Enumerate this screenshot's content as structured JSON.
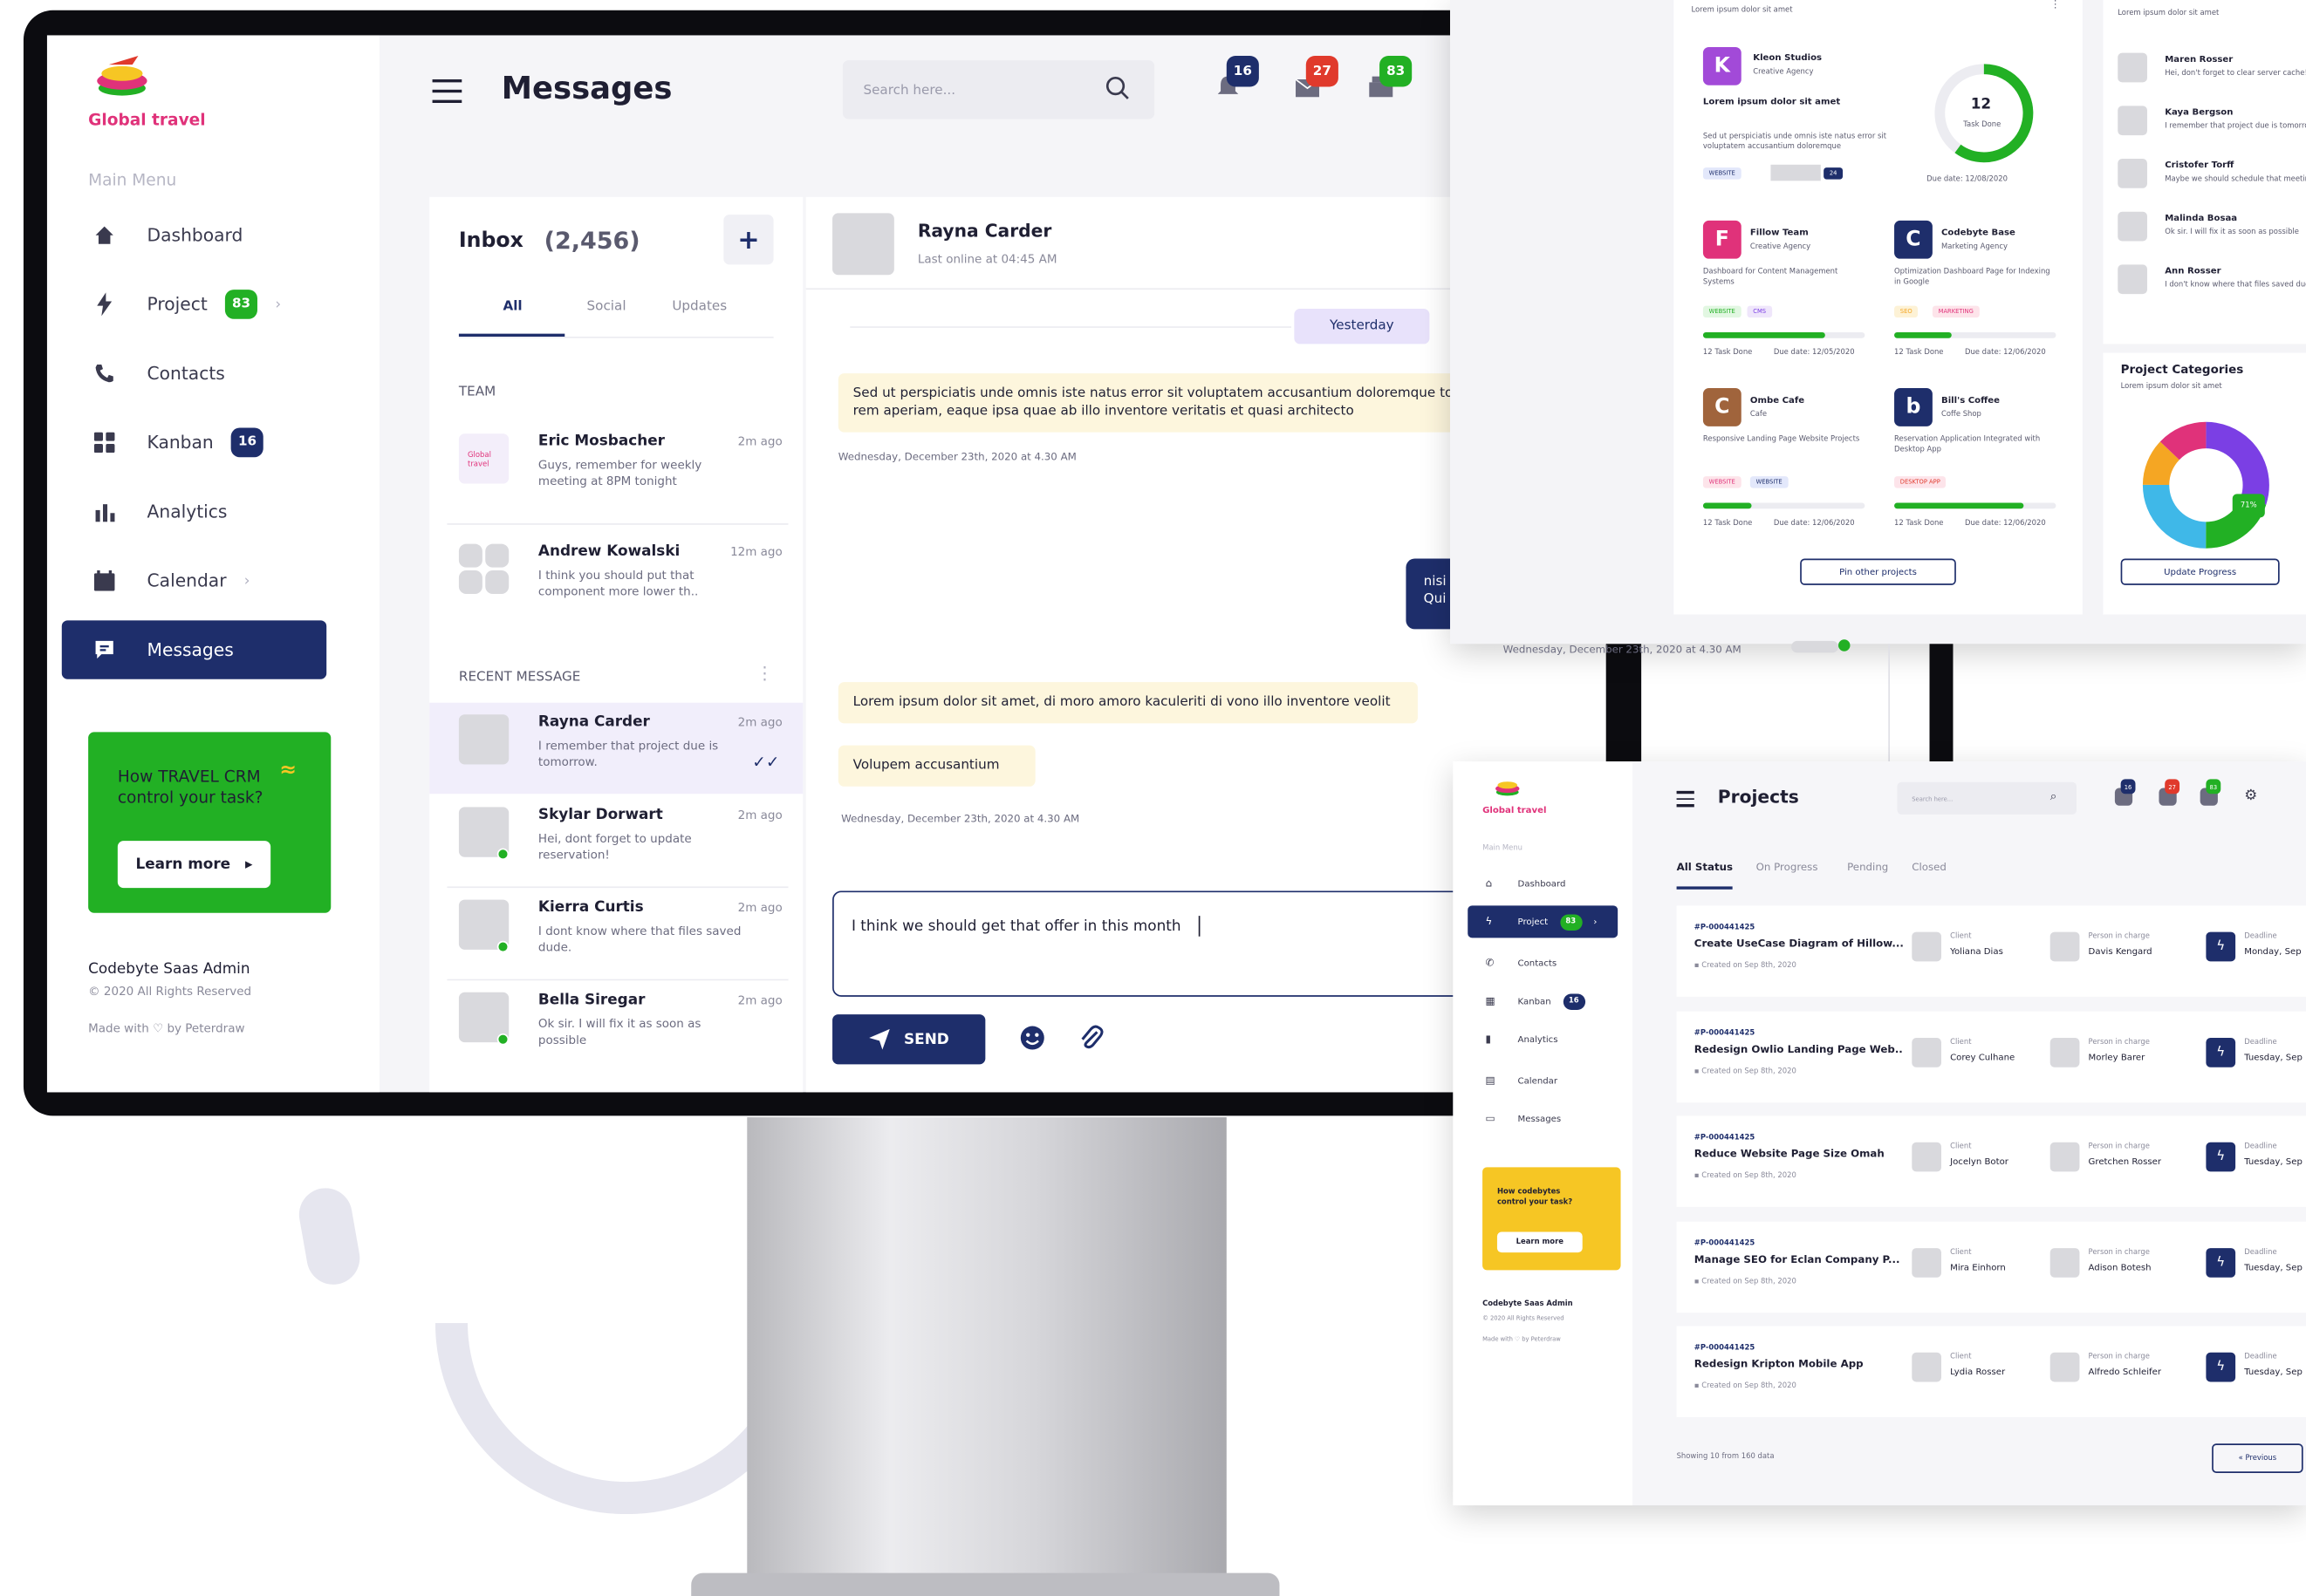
{
  "colors": {
    "primary": "#1e2e6b",
    "green": "#22b024",
    "red": "#e03a2c",
    "yellow": "#f6c624",
    "pink": "#e0327a"
  },
  "app": {
    "logo_text": "Global travel",
    "menu_title": "Main Menu",
    "page_title": "Messages",
    "search_placeholder": "Search here..."
  },
  "nav": [
    {
      "label": "Dashboard",
      "icon": "home-icon"
    },
    {
      "label": "Project",
      "icon": "bolt-icon",
      "badge": "83"
    },
    {
      "label": "Contacts",
      "icon": "phone-icon"
    },
    {
      "label": "Kanban",
      "icon": "grid-icon",
      "badge": "16"
    },
    {
      "label": "Analytics",
      "icon": "bar-chart-icon"
    },
    {
      "label": "Calendar",
      "icon": "calendar-icon"
    },
    {
      "label": "Messages",
      "icon": "message-icon"
    }
  ],
  "promo": {
    "text": "How TRAVEL CRM control your task?",
    "button": "Learn more"
  },
  "footer": {
    "title": "Codebyte Saas Admin",
    "copyright": "© 2020 All Rights Reserved",
    "made": "Made with ♡ by Peterdraw"
  },
  "topbar": {
    "bell_badge": "16",
    "mail_badge": "27",
    "box_badge": "83"
  },
  "inbox": {
    "title": "Inbox",
    "count": "(2,456)",
    "add": "+",
    "tabs": [
      "All",
      "Social",
      "Updates"
    ],
    "team_label": "TEAM",
    "recent_label": "RECENT MESSAGE",
    "team": [
      {
        "name": "Eric Mosbacher",
        "time": "2m ago",
        "text": "Guys, remember for weekly meeting at 8PM tonight"
      },
      {
        "name": "Andrew Kowalski",
        "time": "12m ago",
        "text": "I think you should put that component more lower th.."
      }
    ],
    "recent": [
      {
        "name": "Rayna Carder",
        "time": "2m ago",
        "text": "I remember that project due is tomorrow."
      },
      {
        "name": "Skylar Dorwart",
        "time": "2m ago",
        "text": "Hei, dont forget to update reservation!"
      },
      {
        "name": "Kierra Curtis",
        "time": "2m ago",
        "text": "I dont know where that files saved dude."
      },
      {
        "name": "Bella Siregar",
        "time": "2m ago",
        "text": "Ok sir. I will fix it as soon as possible"
      }
    ]
  },
  "chat": {
    "name": "Rayna Carder",
    "status": "Last online at 04:45 AM",
    "date_pill": "Yesterday",
    "msg1": "Sed ut perspiciatis unde omnis iste natus error sit voluptatem accusantium doloremque totam rem aperiam, eaque ipsa quae ab illo inventore veritatis et quasi architecto",
    "time1": "Wednesday, December 23th, 2020  at 4.30 AM",
    "out_partial": "nisi Qui",
    "out_time": "Wednesday, December 23th, 2020 at 4.30 AM",
    "msg2": "Lorem ipsum dolor sit amet, di moro amoro kaculeriti di vono illo inventore veolit",
    "msg3": "Volupem accusantium",
    "time2": "Wednesday, December 23th, 2020  at 4.30 AM",
    "composer": "I think we should get that offer in this month",
    "send": "SEND"
  },
  "dash_card": {
    "header_sub": "Lorem ipsum dolor sit amet",
    "featured": {
      "letter": "K",
      "name": "Kleon Studios",
      "sub": "Creative Agency",
      "title": "Lorem ipsum dolor sit amet",
      "desc": "Sed ut perspiciatis unde omnis iste natus error sit voluptatem accusantium doloremque",
      "tag": "WEBSITE",
      "tag2": "24",
      "donut_value": "12",
      "donut_label": "Task Done",
      "due": "Due date: 12/08/2020",
      "progress": 0.6
    },
    "projects": [
      {
        "letter": "F",
        "name": "Fillow Team",
        "sub": "Creative Agency",
        "title": "Dashboard for Content Management Systems",
        "tags": [
          "WEBSITE",
          "CMS"
        ],
        "progress": 0.75,
        "done": "12 Task Done",
        "due": "Due date: 12/05/2020"
      },
      {
        "letter": "C",
        "name": "Codebyte Base",
        "sub": "Marketing Agency",
        "title": "Optimization Dashboard Page for Indexing in Google",
        "tags": [
          "SEO",
          "MARKETING"
        ],
        "progress": 0.35,
        "done": "12 Task Done",
        "due": "Due date: 12/06/2020"
      },
      {
        "letter": "C",
        "name": "Ombe Cafe",
        "sub": "Cafe",
        "title": "Responsive Landing Page Website Projects",
        "tags": [
          "WEBSITE",
          "WEBSITE"
        ],
        "progress": 0.3,
        "done": "12 Task Done",
        "due": "Due date: 12/06/2020"
      },
      {
        "letter": "b",
        "name": "Bill's Coffee",
        "sub": "Coffe Shop",
        "title": "Reservation Application Integrated with Desktop App",
        "tags": [
          "DESKTOP APP"
        ],
        "progress": 0.8,
        "done": "12 Task Done",
        "due": "Due date: 12/06/2020"
      }
    ],
    "pin_button": "Pin other projects",
    "right_sub": "Lorem ipsum dolor sit amet",
    "people": [
      {
        "name": "Maren Rosser",
        "text": "Hei, don't forget to clear server cache!"
      },
      {
        "name": "Kaya Bergson",
        "text": "I remember that project due is tomorrow"
      },
      {
        "name": "Cristofer Torff",
        "text": "Maybe we should schedule that meeting"
      },
      {
        "name": "Malinda Bosaa",
        "text": "Ok sir. I will fix it as soon as possible"
      },
      {
        "name": "Ann Rosser",
        "text": "I don't know where that files saved dude"
      }
    ],
    "categories_title": "Project Categories",
    "categories_sub": "Lorem ipsum dolor sit amet",
    "donut_label": "71%",
    "update_button": "Update Progress",
    "chart_data": {
      "type": "pie",
      "title": "Project Categories",
      "slices": [
        {
          "color": "#7b3fe4",
          "value": 30
        },
        {
          "color": "#22b024",
          "value": 20
        },
        {
          "color": "#3fb8e8",
          "value": 25
        },
        {
          "color": "#f5a623",
          "value": 12
        },
        {
          "color": "#e0327a",
          "value": 13
        }
      ]
    }
  },
  "proj_card": {
    "logo_text": "Global travel",
    "page_title": "Projects",
    "search_placeholder": "Search here...",
    "bell_badge": "16",
    "mail_badge": "27",
    "box_badge": "83",
    "menu_title": "Main Menu",
    "nav": [
      "Dashboard",
      "Project",
      "Contacts",
      "Kanban",
      "Analytics",
      "Calendar",
      "Messages"
    ],
    "nav_badges": {
      "project": "83",
      "kanban": "16"
    },
    "promo_text": "How codebytes control your task?",
    "promo_button": "Learn more",
    "footer1": "Codebyte Saas Admin",
    "footer2": "© 2020 All Rights Reserved",
    "footer3": "Made with ♡ by Peterdraw",
    "tabs": [
      "All Status",
      "On Progress",
      "Pending",
      "Closed"
    ],
    "col_client": "Client",
    "col_person": "Person in charge",
    "col_deadline": "Deadline",
    "rows": [
      {
        "id": "#P-000441425",
        "title": "Create UseCase Diagram of Hillow...",
        "created": "Created on Sep 8th, 2020",
        "client": "Yoliana Dias",
        "person": "Davis Kengard",
        "deadline": "Monday, Sep"
      },
      {
        "id": "#P-000441425",
        "title": "Redesign Owlio Landing Page Web...",
        "created": "Created on Sep 8th, 2020",
        "client": "Corey Culhane",
        "person": "Morley Barer",
        "deadline": "Tuesday, Sep"
      },
      {
        "id": "#P-000441425",
        "title": "Reduce Website Page Size Omah",
        "created": "Created on Sep 8th, 2020",
        "client": "Jocelyn Botor",
        "person": "Gretchen Rosser",
        "deadline": "Tuesday, Sep"
      },
      {
        "id": "#P-000441425",
        "title": "Manage SEO for Eclan Company P...",
        "created": "Created on Sep 8th, 2020",
        "client": "Mira Einhorn",
        "person": "Adison Botesh",
        "deadline": "Tuesday, Sep"
      },
      {
        "id": "#P-000441425",
        "title": "Redesign Kripton Mobile App",
        "created": "Created on Sep 8th, 2020",
        "client": "Lydia Rosser",
        "person": "Alfredo Schleifer",
        "deadline": "Tuesday, Sep"
      }
    ],
    "showing": "Showing 10 from 160 data",
    "prev": "« Previous"
  }
}
